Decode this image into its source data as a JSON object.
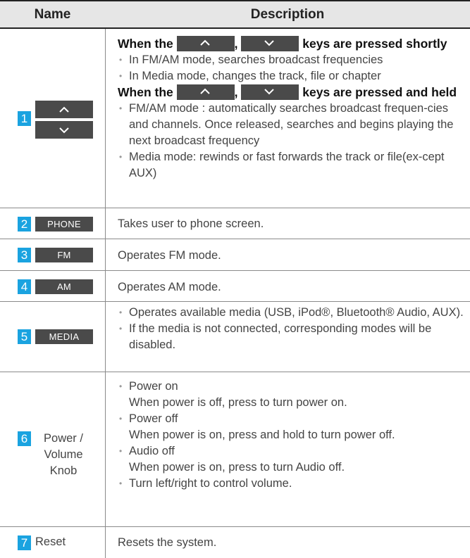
{
  "header": {
    "name": "Name",
    "description": "Description"
  },
  "rows": [
    {
      "num": "1",
      "heading_short": {
        "pre": "When the",
        "sep": ",",
        "post": "keys are pressed shortly"
      },
      "short_items": [
        "In FM/AM mode, searches broadcast frequencies",
        "In Media mode, changes the track, file or chapter"
      ],
      "heading_held": {
        "pre": "When the",
        "sep": ",",
        "post": "keys are pressed and held"
      },
      "held_items": [
        "FM/AM mode : automatically searches broadcast frequen-cies and channels. Once released, searches and begins playing the next broadcast frequency",
        "Media mode: rewinds or fast forwards the track or file(ex-cept AUX)"
      ]
    },
    {
      "num": "2",
      "key": "PHONE",
      "desc": "Takes user to phone screen."
    },
    {
      "num": "3",
      "key": "FM",
      "desc": "Operates FM mode."
    },
    {
      "num": "4",
      "key": "AM",
      "desc": "Operates AM mode."
    },
    {
      "num": "5",
      "key": "MEDIA",
      "items": [
        "Operates available media (USB, iPod®, Bluetooth® Audio, AUX).",
        "If the media is not connected, corresponding modes will be disabled."
      ]
    },
    {
      "num": "6",
      "label": "Power / Volume Knob",
      "items": [
        {
          "title": "Power on",
          "text": "When power is off, press to turn power on."
        },
        {
          "title": "Power off",
          "text": "When power is on, press and hold to turn power off."
        },
        {
          "title": "Audio off",
          "text": "When power is on, press to turn Audio off."
        },
        {
          "title": "Turn left/right to control volume.",
          "text": ""
        }
      ]
    },
    {
      "num": "7",
      "label": "Reset",
      "desc": "Resets the system."
    }
  ],
  "colors": {
    "number_badge": "#1aa3e0",
    "key_bg": "#4a4a4a",
    "header_bg": "#e6e6e6"
  },
  "icons": {
    "up": "chevron-up-icon",
    "down": "chevron-down-icon"
  }
}
